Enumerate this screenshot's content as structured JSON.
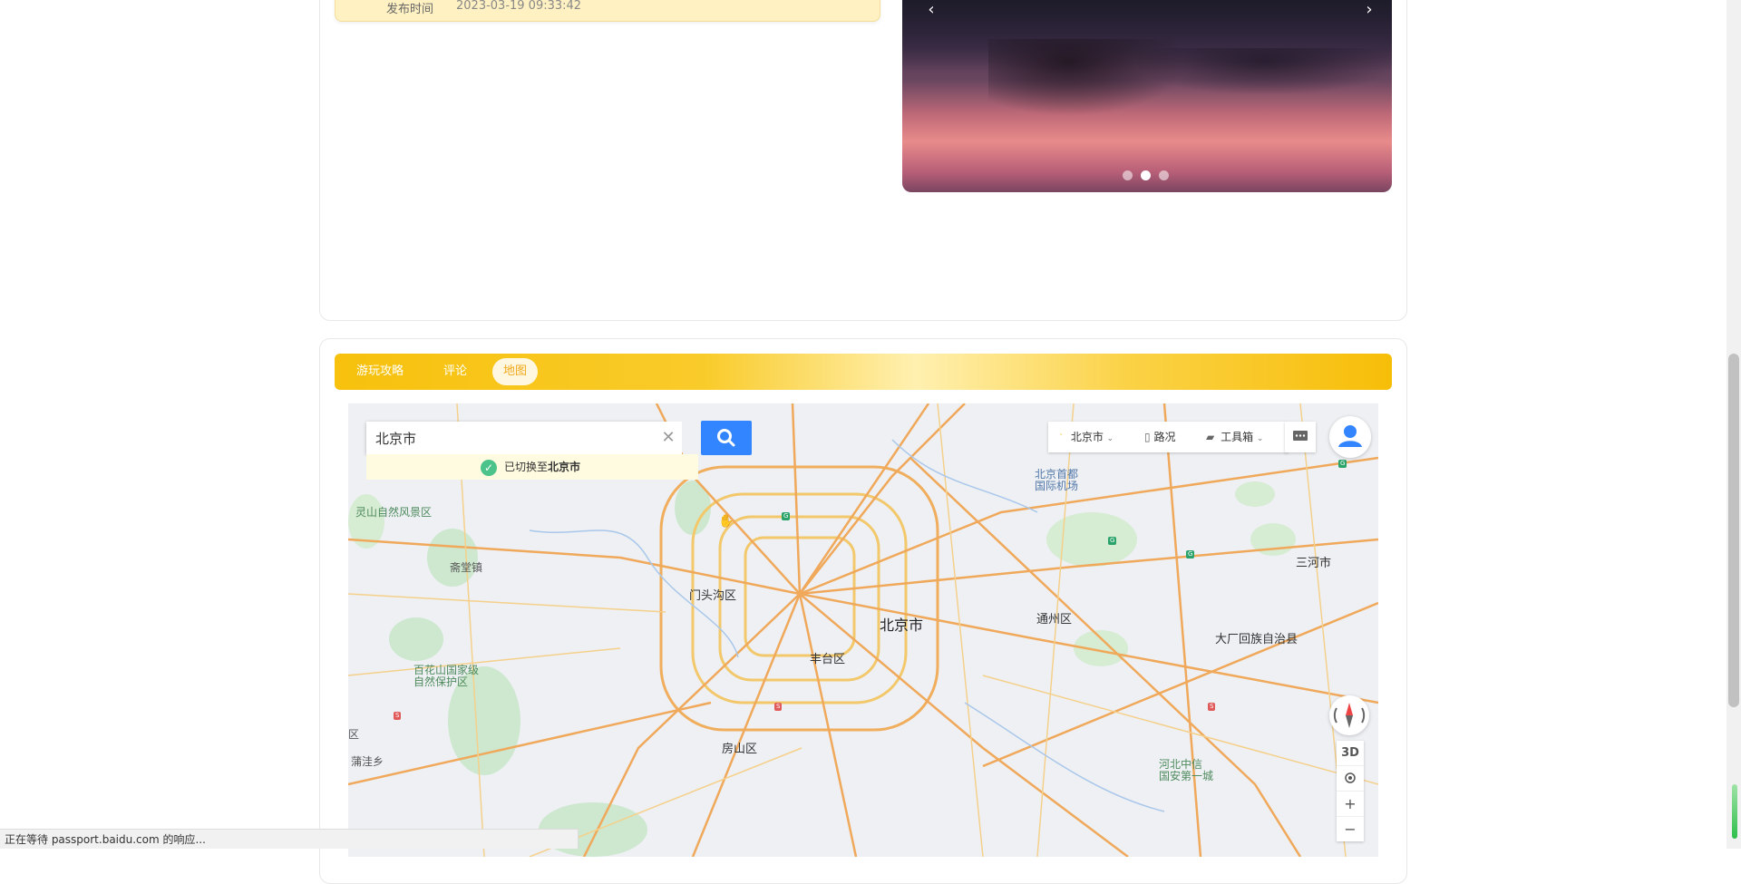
{
  "info": {
    "label": "发布时间",
    "value": "2023-03-19 09:33:42"
  },
  "carousel": {
    "prev": "‹",
    "next": "›",
    "slide_count": 3,
    "active_slide": 2
  },
  "tabs": [
    {
      "label": "游玩攻略",
      "active": false
    },
    {
      "label": "评论",
      "active": false
    },
    {
      "label": "地图",
      "active": true
    }
  ],
  "map": {
    "search_value": "北京市",
    "switch_tip_prefix": "已切换至",
    "switch_tip_city": "北京市",
    "city_selector": "北京市",
    "traffic": "路况",
    "toolbox": "工具箱",
    "btn_3d": "3D",
    "btn_zoom_in": "+",
    "btn_zoom_out": "−",
    "labels": {
      "beijing": "北京市",
      "mentougou": "门头沟区",
      "fengtai": "丰台区",
      "tongzhou": "通州区",
      "fangshan": "房山区",
      "sanhe": "三河市",
      "dachang": "大厂回族自治县",
      "airport": "北京首都\n国际机场",
      "lingshan": "灵山自然风景区",
      "zhaitang": "斋堂镇",
      "baihuashan": "百花山国家级\n自然保护区",
      "hebei": "河北中信\n国安第一城",
      "pudian": "蒲洼乡",
      "qu_left": "区"
    }
  },
  "status_text": "正在等待 passport.baidu.com 的响应...",
  "colors": {
    "accent": "#f7c10d",
    "search_btn": "#3385ff",
    "tab_active_text": "#f0a81c"
  }
}
